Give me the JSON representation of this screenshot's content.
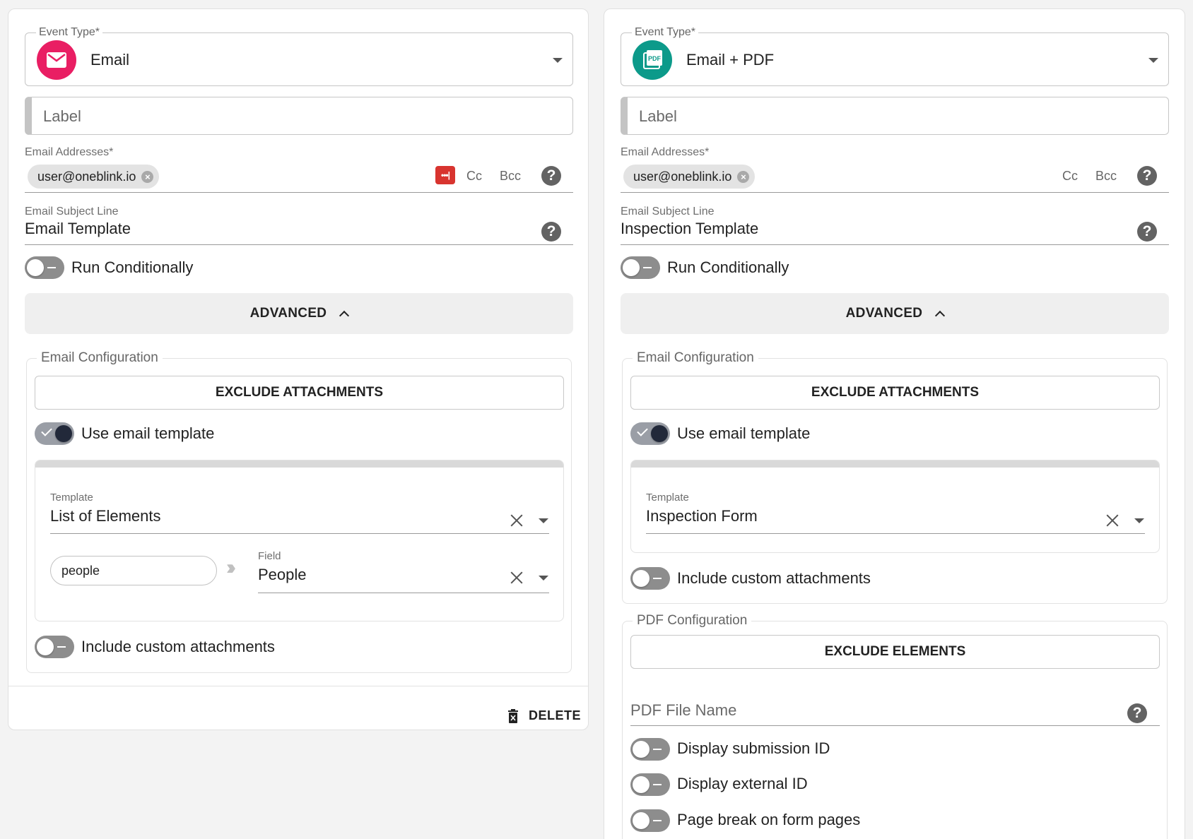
{
  "left": {
    "event_type_legend": "Event Type*",
    "event_type_value": "Email",
    "event_type_icon": "email-envelope-icon",
    "event_type_color": "#e91e63",
    "label_placeholder": "Label",
    "email_addresses_label": "Email Addresses*",
    "email_chip": "user@oneblink.io",
    "password_manager_icon": "•••|",
    "cc": "Cc",
    "bcc": "Bcc",
    "subject_label": "Email Subject Line",
    "subject_value": "Email Template",
    "run_conditionally": "Run Conditionally",
    "advanced": "ADVANCED",
    "email_config_legend": "Email Configuration",
    "exclude_attachments": "EXCLUDE ATTACHMENTS",
    "use_email_template": "Use email template",
    "template_label": "Template",
    "template_value": "List of Elements",
    "mapping_input": "people",
    "field_label": "Field",
    "field_value": "People",
    "include_custom_attachments": "Include custom attachments",
    "delete": "DELETE"
  },
  "right": {
    "event_type_legend": "Event Type*",
    "event_type_value": "Email + PDF",
    "event_type_icon": "pdf-icon",
    "event_type_color": "#0c9a8a",
    "pdf_badge": "PDF",
    "label_placeholder": "Label",
    "email_addresses_label": "Email Addresses*",
    "email_chip": "user@oneblink.io",
    "cc": "Cc",
    "bcc": "Bcc",
    "subject_label": "Email Subject Line",
    "subject_value": "Inspection Template",
    "run_conditionally": "Run Conditionally",
    "advanced": "ADVANCED",
    "email_config_legend": "Email Configuration",
    "exclude_attachments": "EXCLUDE ATTACHMENTS",
    "use_email_template": "Use email template",
    "template_label": "Template",
    "template_value": "Inspection Form",
    "include_custom_attachments": "Include custom attachments",
    "pdf_config_legend": "PDF Configuration",
    "exclude_elements": "EXCLUDE ELEMENTS",
    "pdf_file_name_placeholder": "PDF File Name",
    "display_submission_id": "Display submission ID",
    "display_external_id": "Display external ID",
    "page_break": "Page break on form pages"
  },
  "help_glyph": "?",
  "clear_glyph": "×"
}
